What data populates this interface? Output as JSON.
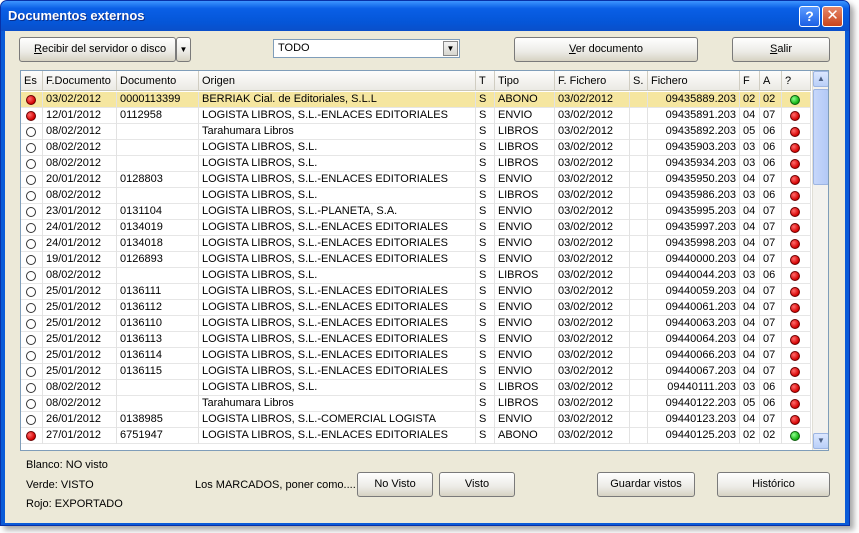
{
  "window": {
    "title": "Documentos externos",
    "help_glyph": "?",
    "close_glyph": "✕"
  },
  "toolbar": {
    "receive_label": "Recibir del servidor o disco",
    "receive_mnemonic": "R",
    "receive_rest": "ecibir del servidor o disco",
    "filter_value": "TODO",
    "view_mnemonic": "V",
    "view_rest": "er documento",
    "exit_mnemonic": "S",
    "exit_rest": "alir",
    "dropdown_glyph": "▼"
  },
  "grid": {
    "columns": [
      "Es",
      "F.Documento",
      "Documento",
      "Origen",
      "T",
      "Tipo",
      "F. Fichero",
      "S.",
      "Fichero",
      "F",
      "A",
      "?"
    ],
    "rows": [
      {
        "es": "rojo",
        "fdoc": "03/02/2012",
        "doc": "0000113399",
        "origen": "BERRIAK Cial. de Editoriales, S.L.L",
        "t": "S",
        "tipo": "ABONO",
        "ffich": "03/02/2012",
        "s": "",
        "fichero": "09435889.203",
        "f": "02",
        "a": "02",
        "q": "verde",
        "sel": true
      },
      {
        "es": "rojo",
        "fdoc": "12/01/2012",
        "doc": "0112958",
        "origen": "LOGISTA LIBROS, S.L.-ENLACES EDITORIALES",
        "t": "S",
        "tipo": "ENVIO",
        "ffich": "03/02/2012",
        "s": "",
        "fichero": "09435891.203",
        "f": "04",
        "a": "07",
        "q": "rojo"
      },
      {
        "es": "blanco",
        "fdoc": "08/02/2012",
        "doc": "",
        "origen": "Tarahumara Libros",
        "t": "S",
        "tipo": "LIBROS",
        "ffich": "03/02/2012",
        "s": "",
        "fichero": "09435892.203",
        "f": "05",
        "a": "06",
        "q": "rojo"
      },
      {
        "es": "blanco",
        "fdoc": "08/02/2012",
        "doc": "",
        "origen": "LOGISTA LIBROS, S.L.",
        "t": "S",
        "tipo": "LIBROS",
        "ffich": "03/02/2012",
        "s": "",
        "fichero": "09435903.203",
        "f": "03",
        "a": "06",
        "q": "rojo"
      },
      {
        "es": "blanco",
        "fdoc": "08/02/2012",
        "doc": "",
        "origen": "LOGISTA LIBROS, S.L.",
        "t": "S",
        "tipo": "LIBROS",
        "ffich": "03/02/2012",
        "s": "",
        "fichero": "09435934.203",
        "f": "03",
        "a": "06",
        "q": "rojo"
      },
      {
        "es": "blanco",
        "fdoc": "20/01/2012",
        "doc": "0128803",
        "origen": "LOGISTA LIBROS, S.L.-ENLACES EDITORIALES",
        "t": "S",
        "tipo": "ENVIO",
        "ffich": "03/02/2012",
        "s": "",
        "fichero": "09435950.203",
        "f": "04",
        "a": "07",
        "q": "rojo"
      },
      {
        "es": "blanco",
        "fdoc": "08/02/2012",
        "doc": "",
        "origen": "LOGISTA LIBROS, S.L.",
        "t": "S",
        "tipo": "LIBROS",
        "ffich": "03/02/2012",
        "s": "",
        "fichero": "09435986.203",
        "f": "03",
        "a": "06",
        "q": "rojo"
      },
      {
        "es": "blanco",
        "fdoc": "23/01/2012",
        "doc": "0131104",
        "origen": "LOGISTA LIBROS, S.L.-PLANETA, S.A.",
        "t": "S",
        "tipo": "ENVIO",
        "ffich": "03/02/2012",
        "s": "",
        "fichero": "09435995.203",
        "f": "04",
        "a": "07",
        "q": "rojo"
      },
      {
        "es": "blanco",
        "fdoc": "24/01/2012",
        "doc": "0134019",
        "origen": "LOGISTA LIBROS, S.L.-ENLACES EDITORIALES",
        "t": "S",
        "tipo": "ENVIO",
        "ffich": "03/02/2012",
        "s": "",
        "fichero": "09435997.203",
        "f": "04",
        "a": "07",
        "q": "rojo"
      },
      {
        "es": "blanco",
        "fdoc": "24/01/2012",
        "doc": "0134018",
        "origen": "LOGISTA LIBROS, S.L.-ENLACES EDITORIALES",
        "t": "S",
        "tipo": "ENVIO",
        "ffich": "03/02/2012",
        "s": "",
        "fichero": "09435998.203",
        "f": "04",
        "a": "07",
        "q": "rojo"
      },
      {
        "es": "blanco",
        "fdoc": "19/01/2012",
        "doc": "0126893",
        "origen": "LOGISTA LIBROS, S.L.-ENLACES EDITORIALES",
        "t": "S",
        "tipo": "ENVIO",
        "ffich": "03/02/2012",
        "s": "",
        "fichero": "09440000.203",
        "f": "04",
        "a": "07",
        "q": "rojo"
      },
      {
        "es": "blanco",
        "fdoc": "08/02/2012",
        "doc": "",
        "origen": "LOGISTA LIBROS, S.L.",
        "t": "S",
        "tipo": "LIBROS",
        "ffich": "03/02/2012",
        "s": "",
        "fichero": "09440044.203",
        "f": "03",
        "a": "06",
        "q": "rojo"
      },
      {
        "es": "blanco",
        "fdoc": "25/01/2012",
        "doc": "0136111",
        "origen": "LOGISTA LIBROS, S.L.-ENLACES EDITORIALES",
        "t": "S",
        "tipo": "ENVIO",
        "ffich": "03/02/2012",
        "s": "",
        "fichero": "09440059.203",
        "f": "04",
        "a": "07",
        "q": "rojo"
      },
      {
        "es": "blanco",
        "fdoc": "25/01/2012",
        "doc": "0136112",
        "origen": "LOGISTA LIBROS, S.L.-ENLACES EDITORIALES",
        "t": "S",
        "tipo": "ENVIO",
        "ffich": "03/02/2012",
        "s": "",
        "fichero": "09440061.203",
        "f": "04",
        "a": "07",
        "q": "rojo"
      },
      {
        "es": "blanco",
        "fdoc": "25/01/2012",
        "doc": "0136110",
        "origen": "LOGISTA LIBROS, S.L.-ENLACES EDITORIALES",
        "t": "S",
        "tipo": "ENVIO",
        "ffich": "03/02/2012",
        "s": "",
        "fichero": "09440063.203",
        "f": "04",
        "a": "07",
        "q": "rojo"
      },
      {
        "es": "blanco",
        "fdoc": "25/01/2012",
        "doc": "0136113",
        "origen": "LOGISTA LIBROS, S.L.-ENLACES EDITORIALES",
        "t": "S",
        "tipo": "ENVIO",
        "ffich": "03/02/2012",
        "s": "",
        "fichero": "09440064.203",
        "f": "04",
        "a": "07",
        "q": "rojo"
      },
      {
        "es": "blanco",
        "fdoc": "25/01/2012",
        "doc": "0136114",
        "origen": "LOGISTA LIBROS, S.L.-ENLACES EDITORIALES",
        "t": "S",
        "tipo": "ENVIO",
        "ffich": "03/02/2012",
        "s": "",
        "fichero": "09440066.203",
        "f": "04",
        "a": "07",
        "q": "rojo"
      },
      {
        "es": "blanco",
        "fdoc": "25/01/2012",
        "doc": "0136115",
        "origen": "LOGISTA LIBROS, S.L.-ENLACES EDITORIALES",
        "t": "S",
        "tipo": "ENVIO",
        "ffich": "03/02/2012",
        "s": "",
        "fichero": "09440067.203",
        "f": "04",
        "a": "07",
        "q": "rojo"
      },
      {
        "es": "blanco",
        "fdoc": "08/02/2012",
        "doc": "",
        "origen": "LOGISTA LIBROS, S.L.",
        "t": "S",
        "tipo": "LIBROS",
        "ffich": "03/02/2012",
        "s": "",
        "fichero": "09440111.203",
        "f": "03",
        "a": "06",
        "q": "rojo"
      },
      {
        "es": "blanco",
        "fdoc": "08/02/2012",
        "doc": "",
        "origen": "Tarahumara Libros",
        "t": "S",
        "tipo": "LIBROS",
        "ffich": "03/02/2012",
        "s": "",
        "fichero": "09440122.203",
        "f": "05",
        "a": "06",
        "q": "rojo"
      },
      {
        "es": "blanco",
        "fdoc": "26/01/2012",
        "doc": "0138985",
        "origen": "LOGISTA LIBROS, S.L.-COMERCIAL LOGISTA",
        "t": "S",
        "tipo": "ENVIO",
        "ffich": "03/02/2012",
        "s": "",
        "fichero": "09440123.203",
        "f": "04",
        "a": "07",
        "q": "rojo"
      },
      {
        "es": "rojo",
        "fdoc": "27/01/2012",
        "doc": "6751947",
        "origen": "LOGISTA LIBROS, S.L.-ENLACES EDITORIALES",
        "t": "S",
        "tipo": "ABONO",
        "ffich": "03/02/2012",
        "s": "",
        "fichero": "09440125.203",
        "f": "02",
        "a": "02",
        "q": "verde"
      }
    ]
  },
  "scrollbar": {
    "up_glyph": "▲",
    "down_glyph": "▼"
  },
  "legend": {
    "blanco": "Blanco: NO visto",
    "verde": "Verde: VISTO",
    "rojo": "Rojo: EXPORTADO"
  },
  "footer": {
    "hint": "Los MARCADOS, poner como....",
    "no_visto_label": "No Visto",
    "visto_label": "Visto",
    "guardar_label": "Guardar vistos",
    "historico_label": "Histórico"
  },
  "colors": {
    "title_blue": "#0a5bd8",
    "selected_row": "#f5e6a0",
    "status_red": "#d40000",
    "status_green": "#10b010"
  }
}
